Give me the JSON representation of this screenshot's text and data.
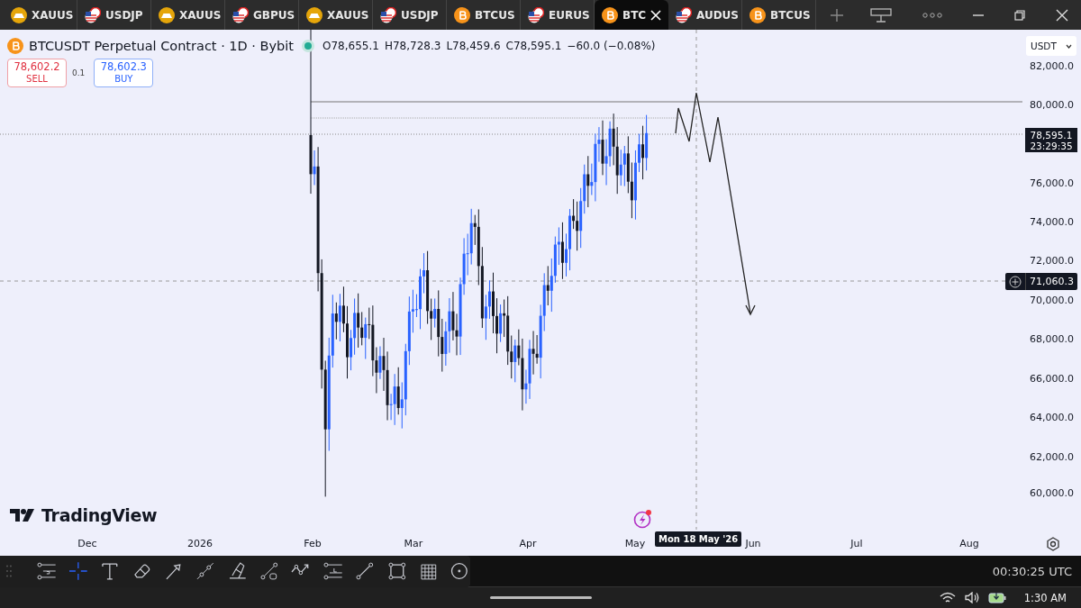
{
  "tabs": [
    {
      "label": "XAUUS",
      "kind": "metal",
      "selected": false
    },
    {
      "label": "USDJP",
      "kind": "forex",
      "selected": false
    },
    {
      "label": "XAUUS",
      "kind": "metal",
      "selected": false
    },
    {
      "label": "GBPUS",
      "kind": "forex",
      "selected": false
    },
    {
      "label": "XAUUS",
      "kind": "metal",
      "selected": false
    },
    {
      "label": "USDJP",
      "kind": "forex",
      "selected": false
    },
    {
      "label": "BTCUS",
      "kind": "crypto",
      "selected": false
    },
    {
      "label": "EURUS",
      "kind": "forex",
      "selected": false
    },
    {
      "label": "BTC",
      "kind": "crypto",
      "selected": true
    },
    {
      "label": "AUDUS",
      "kind": "forex",
      "selected": false
    },
    {
      "label": "BTCUS",
      "kind": "crypto",
      "selected": false
    }
  ],
  "legend": {
    "symbol": "BTCUSDT Perpetual Contract · 1D · Bybit",
    "market_open": true,
    "ohlc": [
      "O78,655.1",
      "H78,728.3",
      "L78,459.6",
      "C78,595.1",
      "−60.0 (−0.08%)"
    ]
  },
  "trade": {
    "sell_price": "78,602.2",
    "sell_label": "SELL",
    "spread": "0.1",
    "buy_price": "78,602.3",
    "buy_label": "BUY"
  },
  "price_axis": {
    "currency": "USDT",
    "labels": [
      "82,000.0",
      "80,000.0",
      "76,000.0",
      "74,000.0",
      "72,000.0",
      "70,000.0",
      "68,000.0",
      "66,000.0",
      "64,000.0",
      "62,000.0",
      "60,000.0"
    ],
    "last_price": "78,595.1",
    "countdown": "23:29:35",
    "crosshair_price": "71,060.3"
  },
  "time_axis": {
    "labels": [
      "Dec",
      "2026",
      "Feb",
      "Mar",
      "Apr",
      "May",
      "Jun",
      "Jul",
      "Aug"
    ],
    "crosshair_date": "Mon 18 May '26"
  },
  "brand": "TradingView",
  "toolbar": {
    "tools": [
      {
        "selected": false
      },
      {
        "selected": true
      },
      {
        "selected": false
      },
      {
        "selected": false
      },
      {
        "selected": false
      },
      {
        "selected": false
      },
      {
        "selected": false
      },
      {
        "selected": false
      },
      {
        "selected": false
      },
      {
        "selected": false
      },
      {
        "selected": false
      },
      {
        "selected": false
      },
      {
        "selected": false
      }
    ],
    "clock": "00:30:25 UTC"
  },
  "taskbar": {
    "time": "1:30 AM"
  }
}
